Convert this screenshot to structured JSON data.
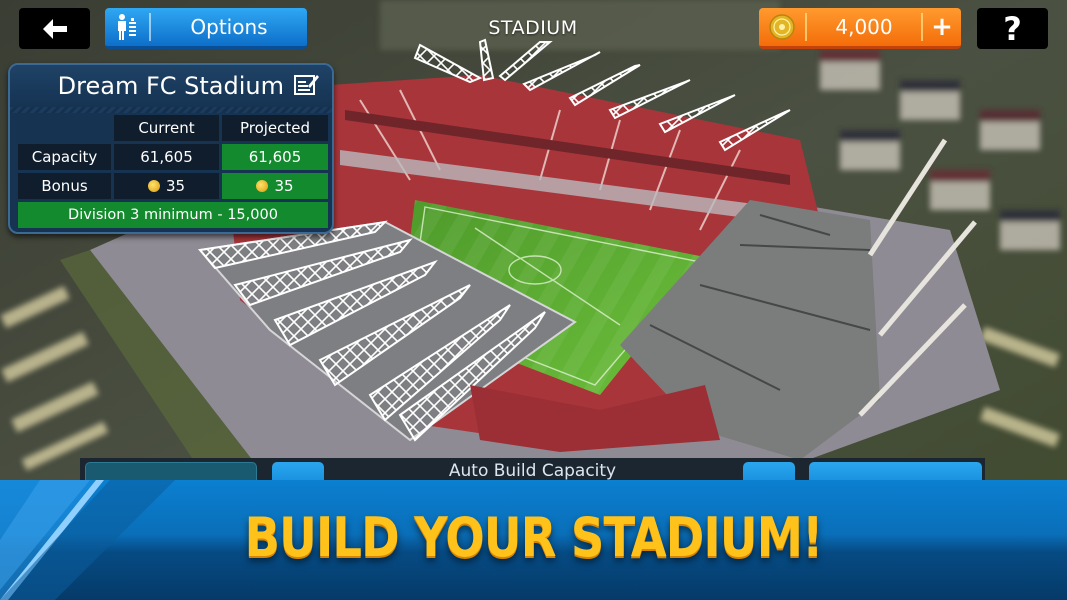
{
  "header": {
    "title": "STADIUM",
    "options_label": "Options",
    "coins": "4,000",
    "help_label": "?"
  },
  "stadium_panel": {
    "name": "Dream FC Stadium",
    "columns": [
      "Current",
      "Projected"
    ],
    "rows": [
      {
        "label": "Capacity",
        "current": "61,605",
        "projected": "61,605"
      },
      {
        "label": "Bonus",
        "current": "35",
        "projected": "35"
      }
    ],
    "requirement": "Division 3 minimum - 15,000"
  },
  "bottom_controls": {
    "auto_build_label": "Auto Build Capacity"
  },
  "promo": {
    "headline": "BUILD YOUR STADIUM!"
  },
  "colors": {
    "options_blue": "#1a8ee0",
    "coins_orange": "#f7820f",
    "positive_green": "#138a2d",
    "panel_navy": "#163352",
    "headline_yellow": "#ffc21a",
    "banner_blue": "#0a6fb9"
  }
}
